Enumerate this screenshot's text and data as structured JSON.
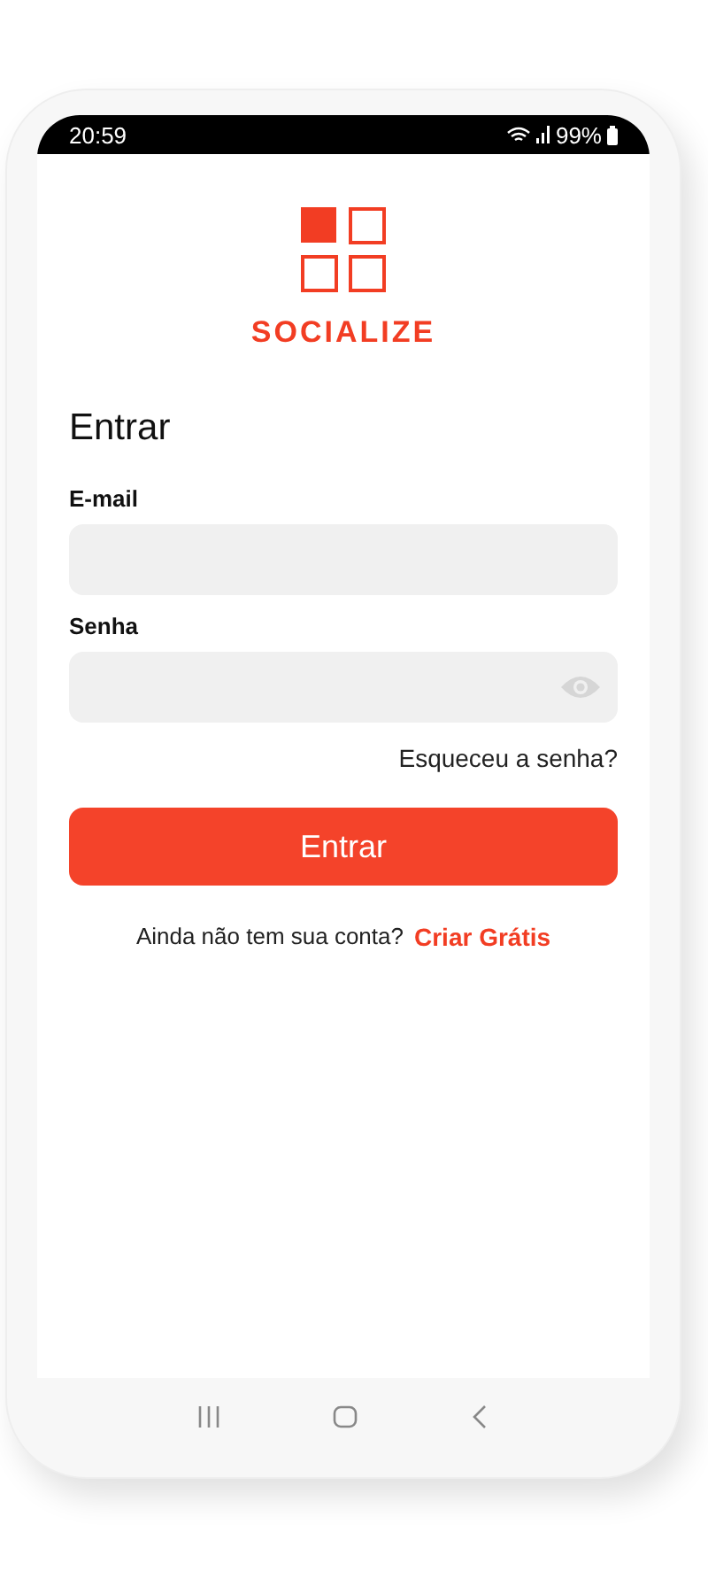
{
  "status_bar": {
    "time": "20:59",
    "battery": "99%"
  },
  "brand": {
    "name": "SOCIALIZE"
  },
  "title": "Entrar",
  "fields": [
    {
      "label": "E-mail",
      "kind": "text"
    },
    {
      "label": "Senha",
      "kind": "password"
    }
  ],
  "forgot_link": "Esqueceu a senha?",
  "submit_button": "Entrar",
  "signup": {
    "prompt": "Ainda não tem sua conta?",
    "link": "Criar Grátis"
  }
}
